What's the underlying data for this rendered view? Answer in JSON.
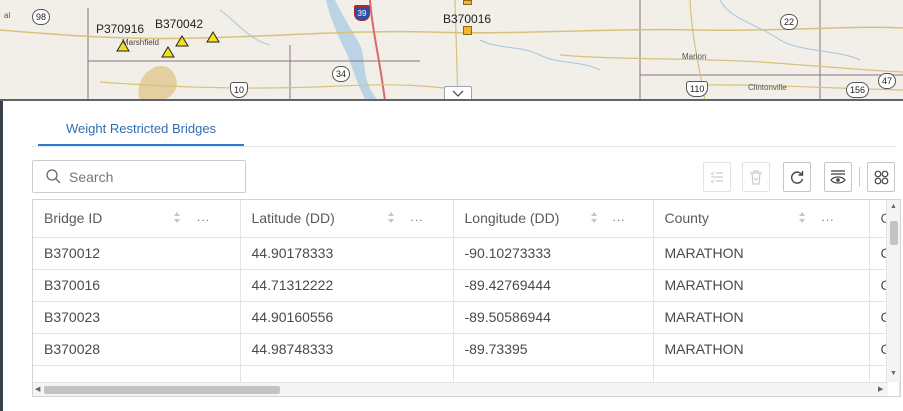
{
  "map": {
    "labels": {
      "p370916": "P370916",
      "b370042": "B370042",
      "b370016": "B370016",
      "marshfield": "Marshfield",
      "marion": "Marion",
      "clintonville": "Clintonville"
    },
    "routes": {
      "r98": "98",
      "r39": "39",
      "r22": "22",
      "r47": "47",
      "r34": "34",
      "r10": "10",
      "r110": "110",
      "r156": "156"
    },
    "colors": {
      "background": "#f1efe8",
      "bridge_marker": "#f5e11a",
      "square_marker": "#f2b531",
      "interstate": "#2c4fa8"
    }
  },
  "panel": {
    "tab_label": "Weight Restricted Bridges",
    "search": {
      "placeholder": "Search",
      "value": ""
    },
    "toolbar": [
      {
        "name": "show-selection-button",
        "icon": "list-check-icon",
        "disabled": true
      },
      {
        "name": "delete-selection-button",
        "icon": "trash-icon",
        "disabled": true
      },
      {
        "name": "refresh-button",
        "icon": "refresh-icon",
        "disabled": false
      },
      {
        "name": "show-hide-columns-button",
        "icon": "eye-list-icon",
        "disabled": false
      },
      {
        "name": "more-options-button",
        "icon": "grid-icon",
        "disabled": false
      }
    ]
  },
  "table": {
    "columns": [
      {
        "label": "Bridge ID",
        "more": "..."
      },
      {
        "label": "Latitude (DD)",
        "more": "..."
      },
      {
        "label": "Longitude (DD)",
        "more": "..."
      },
      {
        "label": "County",
        "more": "..."
      },
      {
        "label": "C",
        "more": ""
      }
    ],
    "rows": [
      [
        "B370012",
        "44.90178333",
        "-90.10273333",
        "MARATHON",
        "C"
      ],
      [
        "B370016",
        "44.71312222",
        "-89.42769444",
        "MARATHON",
        "C"
      ],
      [
        "B370023",
        "44.90160556",
        "-89.50586944",
        "MARATHON",
        "C"
      ],
      [
        "B370028",
        "44.98748333",
        "-89.73395",
        "MARATHON",
        "C"
      ]
    ]
  }
}
